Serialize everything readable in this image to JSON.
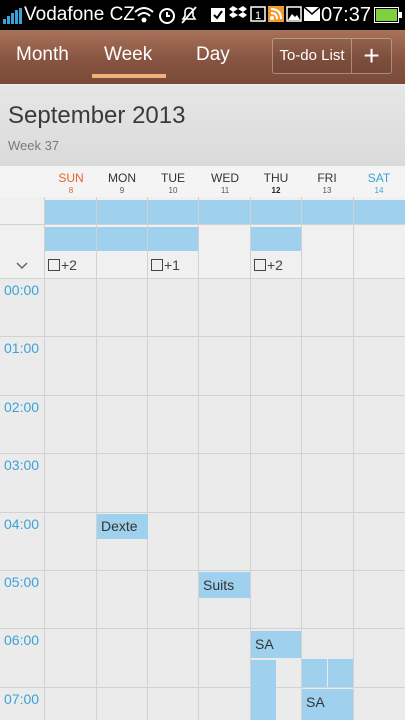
{
  "status_bar": {
    "carrier": "Vodafone CZ",
    "time": "07:37"
  },
  "toolbar": {
    "tabs": [
      "Month",
      "Week",
      "Day"
    ],
    "todo_label": "To-do List",
    "add_label": "+"
  },
  "header": {
    "title": "September 2013",
    "week": "Week 37"
  },
  "days": [
    {
      "name": "SUN",
      "num": "8"
    },
    {
      "name": "MON",
      "num": "9"
    },
    {
      "name": "TUE",
      "num": "10"
    },
    {
      "name": "WED",
      "num": "11"
    },
    {
      "name": "THU",
      "num": "12"
    },
    {
      "name": "FRI",
      "num": "13"
    },
    {
      "name": "SAT",
      "num": "14"
    }
  ],
  "more_counts": {
    "sun": "+2",
    "tue": "+1",
    "thu": "+2"
  },
  "hours": [
    "00:00",
    "01:00",
    "02:00",
    "03:00",
    "04:00",
    "05:00",
    "06:00",
    "07:00"
  ],
  "events": {
    "mon_0400": "Dexte",
    "wed_0500": "Suits",
    "thu_0600": "SA",
    "fri_0700": "SA"
  },
  "colors": {
    "accent_blue": "#3aa3d6",
    "sunday": "#e0662a",
    "event": "#9fd1ee",
    "toolbar": "#875541"
  }
}
